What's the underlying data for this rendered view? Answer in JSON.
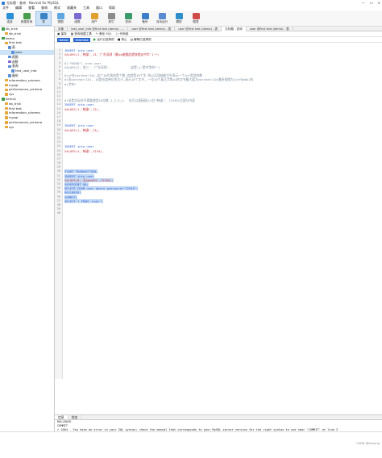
{
  "window": {
    "title": "无标题 - 查询 - Navicat for MySQL",
    "controls": [
      "—",
      "☐",
      "✕"
    ]
  },
  "menu": [
    "文件",
    "编辑",
    "查看",
    "查询",
    "格式",
    "收藏夹",
    "工具",
    "窗口",
    "帮助"
  ],
  "toolbar": [
    {
      "label": "连接",
      "icon": "connection-icon",
      "color": "#2a8fd6"
    },
    {
      "label": "新建查询",
      "icon": "new-query-icon",
      "color": "#4a9c4e"
    },
    {
      "label": "表",
      "icon": "table-icon",
      "color": "#3b82c4",
      "selected": true
    },
    {
      "label": "视图",
      "icon": "view-icon",
      "color": "#5fa7e0"
    },
    {
      "label": "函数",
      "icon": "function-icon",
      "color": "#7d6ad1"
    },
    {
      "label": "用户",
      "icon": "user-icon",
      "color": "#e0a030"
    },
    {
      "label": "其它",
      "icon": "other-icon",
      "color": "#8a8a8a"
    },
    {
      "label": "查询",
      "icon": "query-icon",
      "color": "#3c9b6a"
    },
    {
      "label": "备份",
      "icon": "backup-icon",
      "color": "#3a7fc8"
    },
    {
      "label": "自动运行",
      "icon": "automation-icon",
      "color": "#5a8ad0"
    },
    {
      "label": "模型",
      "icon": "model-icon",
      "color": "#2e8ec9"
    },
    {
      "label": "图表",
      "icon": "chart-icon",
      "color": "#d04a4a"
    }
  ],
  "sidebar": {
    "nodes": [
      {
        "label": "db_trick",
        "level": 0,
        "color": "#3b9b4a"
      },
      {
        "label": "db_trick",
        "level": 1,
        "color": "#e5a83a"
      },
      {
        "label": "demo",
        "level": 0,
        "color": "#3b9b4a"
      },
      {
        "label": "first test",
        "level": 1,
        "color": "#e5a83a"
      },
      {
        "label": "表",
        "level": 2,
        "color": "#5a8fd6"
      },
      {
        "label": "user",
        "level": 3,
        "color": "#5a8fd6",
        "selected": true
      },
      {
        "label": "视图",
        "level": 2,
        "color": "#5a8fd6"
      },
      {
        "label": "函数",
        "level": 2,
        "color": "#7d6ad1"
      },
      {
        "label": "查询",
        "level": 2,
        "color": "#5a8fd6"
      },
      {
        "label": "test_user_info",
        "level": 3,
        "color": "#5a8fd6"
      },
      {
        "label": "备份",
        "level": 2,
        "color": "#5a8fd6"
      },
      {
        "label": "information_schema",
        "level": 1,
        "color": "#e5a83a"
      },
      {
        "label": "mysql",
        "level": 1,
        "color": "#e5a83a"
      },
      {
        "label": "performance_schema",
        "level": 1,
        "color": "#e5a83a"
      },
      {
        "label": "sys",
        "level": 1,
        "color": "#e5a83a"
      },
      {
        "label": "demo1",
        "level": 0,
        "color": "#3b9b4a"
      },
      {
        "label": "db_trick",
        "level": 1,
        "color": "#e5a83a"
      },
      {
        "label": "first test",
        "level": 1,
        "color": "#e5a83a"
      },
      {
        "label": "information_schema",
        "level": 1,
        "color": "#e5a83a"
      },
      {
        "label": "mysql",
        "level": 1,
        "color": "#e5a83a"
      },
      {
        "label": "performance_schema",
        "level": 1,
        "color": "#e5a83a"
      },
      {
        "label": "sys",
        "level": 1,
        "color": "#e5a83a"
      }
    ]
  },
  "tabs": [
    {
      "label": "对象",
      "active": false
    },
    {
      "label": "test_user_info @first test (demo) - ...",
      "active": false
    },
    {
      "label": "user @first test (demo) - 表",
      "active": false
    },
    {
      "label": "user @first test (demo) - 表",
      "active": false
    },
    {
      "label": "无标题 - 查询",
      "active": true
    },
    {
      "label": "user @first test (demo) - 表",
      "active": false
    }
  ],
  "query_toolbar": {
    "save": "保存",
    "builder": "查询创建工具",
    "beautify": "美化 SQL",
    "snippet": "代码段"
  },
  "db_bar": {
    "connection": "demo",
    "database": "first test",
    "run_selected": "运行已选择的",
    "stop": "停止",
    "explain": "解释已选择的"
  },
  "editor": {
    "lines": [
      {
        "t": "INSERT into user",
        "c": "kw"
      },
      {
        "t": "VALUES(1,'韩某',13,'广东深圳（最uo被搬此就快就去中华'1'*)",
        "c": "str"
      },
      {
        "t": "",
        "c": "plain"
      },
      {
        "t": "#(\"Y00X8\") into user",
        "c": "cm"
      },
      {
        "t": "VALUES(2,'张三','广东深圳',          '这是'y'是中华的*')",
        "c": "cm"
      },
      {
        "t": "",
        "c": "plain"
      },
      {
        "t": "#)u*在varchar(10),这个10代表的是个数,也就是10个字,所以汉语结能生生表示一个int类型的数",
        "c": "cm"
      },
      {
        "t": "#)而varchar(10), 10是长度单位的大小,表示10个字节,,一位10个真正字串u1的字节最大值为varchar(10)最多保储为(utf8mb4)的",
        "c": "cm"
      },
      {
        "t": "#)字符*",
        "c": "cm"
      },
      {
        "t": "",
        "c": "plain"
      },
      {
        "t": "",
        "c": "plain"
      },
      {
        "t": "",
        "c": "plain"
      },
      {
        "t": "#)但是实际并不需要使用10位数,1,2,3,4.  也可以直接插入3位\"韩诶\", 12345)后面与内容",
        "c": "cm"
      },
      {
        "t": "INSERT into user",
        "c": "kw"
      },
      {
        "t": "VALUES(1,'韩诶',12),",
        "c": "str"
      },
      {
        "t": "",
        "c": "plain"
      },
      {
        "t": "",
        "c": "plain"
      },
      {
        "t": "",
        "c": "plain"
      },
      {
        "t": "INSERT into user",
        "c": "kw"
      },
      {
        "t": "VALUES(1,'韩诶',13),",
        "c": "str"
      },
      {
        "t": "",
        "c": "plain"
      },
      {
        "t": "",
        "c": "plain"
      },
      {
        "t": "",
        "c": "plain"
      },
      {
        "t": "INSERT into user",
        "c": "kw"
      },
      {
        "t": "VALUES(4,'韩诶',1234),",
        "c": "str"
      },
      {
        "t": "",
        "c": "plain"
      },
      {
        "t": "",
        "c": "plain"
      },
      {
        "t": "",
        "c": "plain"
      },
      {
        "t": "",
        "c": "plain"
      },
      {
        "t": "START TRANSACTION;",
        "c": "kw",
        "hl": true
      },
      {
        "t": "INSERT into user",
        "c": "kw",
        "hl": true
      },
      {
        "t": "VALUES(8,'无hdm5h5',12345);",
        "c": "str",
        "hl": true
      },
      {
        "t": "SAVEPOINT AA;",
        "c": "kw",
        "hl": true
      },
      {
        "t": "DELETE FROM user where password='12345';",
        "c": "kw",
        "hl": true
      },
      {
        "t": "ROLLBACK;",
        "c": "kw",
        "hl": true
      },
      {
        "t": "COMMIT;",
        "c": "kw",
        "hl": true
      },
      {
        "t": "SELECT * FROM `user`;",
        "c": "kw",
        "hl": true
      },
      {
        "t": "",
        "c": "plain"
      },
      {
        "t": "",
        "c": "plain"
      },
      {
        "t": "",
        "c": "plain"
      }
    ]
  },
  "results": {
    "tabs": [
      {
        "label": "信息",
        "active": true
      },
      {
        "label": "状态",
        "active": false
      }
    ],
    "lines": [
      "ROLLBACK",
      "COMMIT",
      "> 1064 - You have an error in your SQL syntax; check the manual that corresponds to your MySQL server version for the right syntax to use near 'COMMIT' at line 2",
      "> 时间: 0s"
    ]
  },
  "statusbar": {
    "watermark": "CSDN @Annong"
  }
}
